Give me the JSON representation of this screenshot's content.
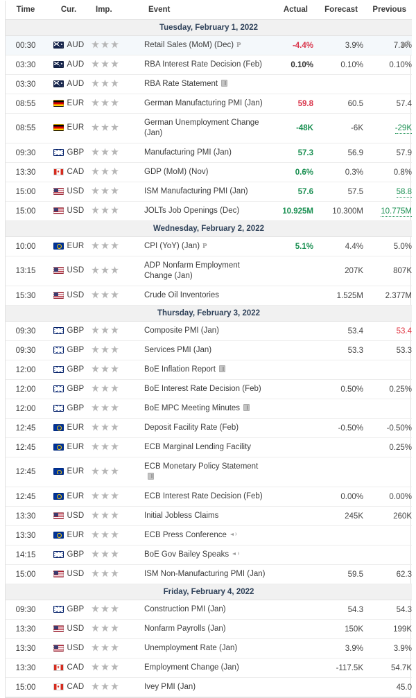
{
  "header": {
    "time": "Time",
    "currency": "Cur.",
    "importance": "Imp.",
    "event": "Event",
    "actual": "Actual",
    "forecast": "Forecast",
    "previous": "Previous"
  },
  "colors": {
    "positive": "#198f51",
    "negative": "#d9344a",
    "neutral": "#444444",
    "date_header_text": "#2e4159",
    "date_header_bg": "#f1f1f1",
    "star": "#b6b6b6",
    "row_highlight": "#f4f8fb"
  },
  "groups": [
    {
      "date": "Tuesday, February 1, 2022",
      "rows": [
        {
          "time": "00:30",
          "currency": "AUD",
          "flag": "AUD",
          "stars": 3,
          "event": "Retail Sales (MoM) (Dec)",
          "marker": "P",
          "actual": "-4.4%",
          "actual_style": "v-down",
          "forecast": "3.9%",
          "forecast_style": "v-plain",
          "previous": "7.3%",
          "previous_style": "v-plain",
          "alert": true,
          "highlight": true
        },
        {
          "time": "03:30",
          "currency": "AUD",
          "flag": "AUD",
          "stars": 3,
          "event": "RBA Interest Rate Decision (Feb)",
          "actual": "0.10%",
          "actual_style": "v-bold",
          "forecast": "0.10%",
          "forecast_style": "v-plain",
          "previous": "0.10%",
          "previous_style": "v-plain"
        },
        {
          "time": "03:30",
          "currency": "AUD",
          "flag": "AUD",
          "stars": 3,
          "event": "RBA Rate Statement",
          "doc": true,
          "actual": "",
          "forecast": "",
          "previous": ""
        },
        {
          "time": "08:55",
          "currency": "EUR",
          "flag": "DEU",
          "stars": 3,
          "event": "German Manufacturing PMI (Jan)",
          "actual": "59.8",
          "actual_style": "v-down",
          "forecast": "60.5",
          "forecast_style": "v-plain",
          "previous": "57.4",
          "previous_style": "v-plain"
        },
        {
          "time": "08:55",
          "currency": "EUR",
          "flag": "DEU",
          "stars": 3,
          "event": "German Unemployment Change (Jan)",
          "actual": "-48K",
          "actual_style": "v-up",
          "forecast": "-6K",
          "forecast_style": "v-plain",
          "previous": "-29K",
          "previous_style": "revised-up"
        },
        {
          "time": "09:30",
          "currency": "GBP",
          "flag": "GBP",
          "stars": 3,
          "event": "Manufacturing PMI (Jan)",
          "actual": "57.3",
          "actual_style": "v-up",
          "forecast": "56.9",
          "forecast_style": "v-plain",
          "previous": "57.9",
          "previous_style": "v-plain"
        },
        {
          "time": "13:30",
          "currency": "CAD",
          "flag": "CAD",
          "stars": 3,
          "event": "GDP (MoM) (Nov)",
          "actual": "0.6%",
          "actual_style": "v-up",
          "forecast": "0.3%",
          "forecast_style": "v-plain",
          "previous": "0.8%",
          "previous_style": "v-plain"
        },
        {
          "time": "15:00",
          "currency": "USD",
          "flag": "USD",
          "stars": 3,
          "event": "ISM Manufacturing PMI (Jan)",
          "actual": "57.6",
          "actual_style": "v-up",
          "forecast": "57.5",
          "forecast_style": "v-plain",
          "previous": "58.8",
          "previous_style": "revised-up"
        },
        {
          "time": "15:00",
          "currency": "USD",
          "flag": "USD",
          "stars": 3,
          "event": "JOLTs Job Openings (Dec)",
          "actual": "10.925M",
          "actual_style": "v-up",
          "forecast": "10.300M",
          "forecast_style": "v-plain",
          "previous": "10.775M",
          "previous_style": "revised-up"
        }
      ]
    },
    {
      "date": "Wednesday, February 2, 2022",
      "rows": [
        {
          "time": "10:00",
          "currency": "EUR",
          "flag": "EUR",
          "stars": 3,
          "event": "CPI (YoY) (Jan)",
          "marker": "P",
          "actual": "5.1%",
          "actual_style": "v-up",
          "forecast": "4.4%",
          "forecast_style": "v-plain",
          "previous": "5.0%",
          "previous_style": "v-plain"
        },
        {
          "time": "13:15",
          "currency": "USD",
          "flag": "USD",
          "stars": 3,
          "event": "ADP Nonfarm Employment Change (Jan)",
          "actual": "",
          "actual_style": "v-plain",
          "forecast": "207K",
          "forecast_style": "v-plain",
          "previous": "807K",
          "previous_style": "v-plain"
        },
        {
          "time": "15:30",
          "currency": "USD",
          "flag": "USD",
          "stars": 3,
          "event": "Crude Oil Inventories",
          "actual": "",
          "actual_style": "v-plain",
          "forecast": "1.525M",
          "forecast_style": "v-plain",
          "previous": "2.377M",
          "previous_style": "v-plain"
        }
      ]
    },
    {
      "date": "Thursday, February 3, 2022",
      "rows": [
        {
          "time": "09:30",
          "currency": "GBP",
          "flag": "GBP",
          "stars": 3,
          "event": "Composite PMI (Jan)",
          "actual": "",
          "actual_style": "v-plain",
          "forecast": "53.4",
          "forecast_style": "v-plain",
          "previous": "53.4",
          "previous_style": "v-red"
        },
        {
          "time": "09:30",
          "currency": "GBP",
          "flag": "GBP",
          "stars": 3,
          "event": "Services PMI (Jan)",
          "actual": "",
          "actual_style": "v-plain",
          "forecast": "53.3",
          "forecast_style": "v-plain",
          "previous": "53.3",
          "previous_style": "v-plain"
        },
        {
          "time": "12:00",
          "currency": "GBP",
          "flag": "GBP",
          "stars": 3,
          "event": "BoE Inflation Report",
          "doc": true,
          "actual": "",
          "forecast": "",
          "previous": ""
        },
        {
          "time": "12:00",
          "currency": "GBP",
          "flag": "GBP",
          "stars": 3,
          "event": "BoE Interest Rate Decision (Feb)",
          "actual": "",
          "actual_style": "v-plain",
          "forecast": "0.50%",
          "forecast_style": "v-plain",
          "previous": "0.25%",
          "previous_style": "v-plain"
        },
        {
          "time": "12:00",
          "currency": "GBP",
          "flag": "GBP",
          "stars": 3,
          "event": "BoE MPC Meeting Minutes",
          "doc": true,
          "actual": "",
          "forecast": "",
          "previous": ""
        },
        {
          "time": "12:45",
          "currency": "EUR",
          "flag": "EUR",
          "stars": 3,
          "event": "Deposit Facility Rate (Feb)",
          "actual": "",
          "actual_style": "v-plain",
          "forecast": "-0.50%",
          "forecast_style": "v-plain",
          "previous": "-0.50%",
          "previous_style": "v-plain"
        },
        {
          "time": "12:45",
          "currency": "EUR",
          "flag": "EUR",
          "stars": 3,
          "event": "ECB Marginal Lending Facility",
          "actual": "",
          "actual_style": "v-plain",
          "forecast": "",
          "forecast_style": "v-plain",
          "previous": "0.25%",
          "previous_style": "v-plain"
        },
        {
          "time": "12:45",
          "currency": "EUR",
          "flag": "EUR",
          "stars": 3,
          "event": "ECB Monetary Policy Statement",
          "doc": true,
          "doc_newline": true,
          "actual": "",
          "forecast": "",
          "previous": ""
        },
        {
          "time": "12:45",
          "currency": "EUR",
          "flag": "EUR",
          "stars": 3,
          "event": "ECB Interest Rate Decision (Feb)",
          "actual": "",
          "actual_style": "v-plain",
          "forecast": "0.00%",
          "forecast_style": "v-plain",
          "previous": "0.00%",
          "previous_style": "v-plain"
        },
        {
          "time": "13:30",
          "currency": "USD",
          "flag": "USD",
          "stars": 3,
          "event": "Initial Jobless Claims",
          "actual": "",
          "actual_style": "v-plain",
          "forecast": "245K",
          "forecast_style": "v-plain",
          "previous": "260K",
          "previous_style": "v-plain"
        },
        {
          "time": "13:30",
          "currency": "EUR",
          "flag": "EUR",
          "stars": 3,
          "event": "ECB Press Conference",
          "speaker": true,
          "actual": "",
          "forecast": "",
          "previous": ""
        },
        {
          "time": "14:15",
          "currency": "GBP",
          "flag": "GBP",
          "stars": 3,
          "event": "BoE Gov Bailey Speaks",
          "speaker": true,
          "actual": "",
          "forecast": "",
          "previous": ""
        },
        {
          "time": "15:00",
          "currency": "USD",
          "flag": "USD",
          "stars": 3,
          "event": "ISM Non-Manufacturing PMI (Jan)",
          "actual": "",
          "actual_style": "v-plain",
          "forecast": "59.5",
          "forecast_style": "v-plain",
          "previous": "62.3",
          "previous_style": "v-plain"
        }
      ]
    },
    {
      "date": "Friday, February 4, 2022",
      "rows": [
        {
          "time": "09:30",
          "currency": "GBP",
          "flag": "GBP",
          "stars": 3,
          "event": "Construction PMI (Jan)",
          "actual": "",
          "actual_style": "v-plain",
          "forecast": "54.3",
          "forecast_style": "v-plain",
          "previous": "54.3",
          "previous_style": "v-plain"
        },
        {
          "time": "13:30",
          "currency": "USD",
          "flag": "USD",
          "stars": 3,
          "event": "Nonfarm Payrolls (Jan)",
          "actual": "",
          "actual_style": "v-plain",
          "forecast": "150K",
          "forecast_style": "v-plain",
          "previous": "199K",
          "previous_style": "v-plain"
        },
        {
          "time": "13:30",
          "currency": "USD",
          "flag": "USD",
          "stars": 3,
          "event": "Unemployment Rate (Jan)",
          "actual": "",
          "actual_style": "v-plain",
          "forecast": "3.9%",
          "forecast_style": "v-plain",
          "previous": "3.9%",
          "previous_style": "v-plain"
        },
        {
          "time": "13:30",
          "currency": "CAD",
          "flag": "CAD",
          "stars": 3,
          "event": "Employment Change (Jan)",
          "actual": "",
          "actual_style": "v-plain",
          "forecast": "-117.5K",
          "forecast_style": "v-plain",
          "previous": "54.7K",
          "previous_style": "v-plain"
        },
        {
          "time": "15:00",
          "currency": "CAD",
          "flag": "CAD",
          "stars": 3,
          "event": "Ivey PMI (Jan)",
          "actual": "",
          "actual_style": "v-plain",
          "forecast": "",
          "forecast_style": "v-plain",
          "previous": "45.0",
          "previous_style": "v-plain"
        }
      ]
    }
  ]
}
